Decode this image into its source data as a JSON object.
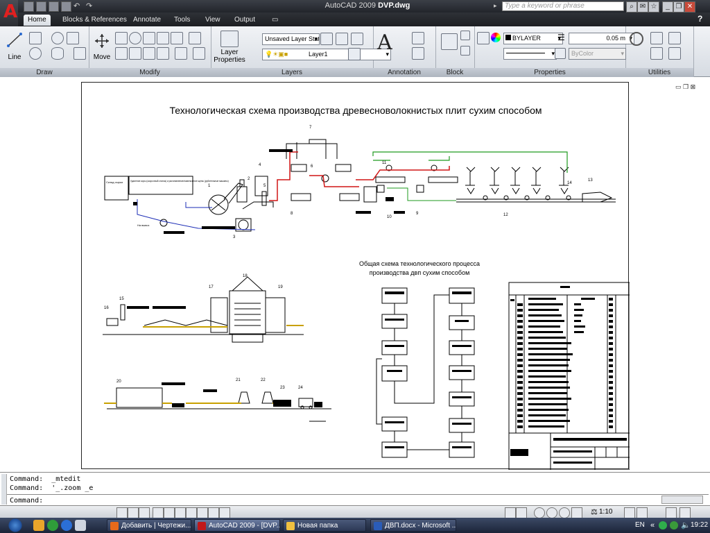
{
  "app": {
    "title": "AutoCAD 2009",
    "document": "DVP.dwg",
    "search_placeholder": "Type a keyword or phrase",
    "help_label": "?"
  },
  "ribbon": {
    "tabs": [
      {
        "label": "Home",
        "active": true
      },
      {
        "label": "Blocks & References"
      },
      {
        "label": "Annotate"
      },
      {
        "label": "Tools"
      },
      {
        "label": "View"
      },
      {
        "label": "Output"
      }
    ],
    "panels": {
      "draw": {
        "title": "Draw",
        "line_label": "Line"
      },
      "modify": {
        "title": "Modify",
        "move_label": "Move"
      },
      "layers": {
        "title": "Layers",
        "layer_properties_label": "Layer Properties",
        "layer_state": "Unsaved Layer State",
        "current_layer": "Layer1"
      },
      "annotation": {
        "title": "Annotation",
        "text_glyph": "A"
      },
      "block": {
        "title": "Block"
      },
      "properties": {
        "title": "Properties",
        "color": "BYLAYER",
        "lineweight": "0.05 m",
        "plotstyle": "ByColor"
      },
      "utilities": {
        "title": "Utilities"
      }
    }
  },
  "drawing": {
    "main_title": "Технологическая схема производства древесноволокнистых плит сухим способом",
    "general_scheme_title_line1": "Общая схема технологического процесса",
    "general_scheme_title_line2": "производства двп сухим способом",
    "box_warehouse": "Склад сырья",
    "box_debarking": "Удаление коры (окорочный станок) и расплавление/измельчение щепы (рубительные машины)",
    "label_discharge": "На вывоз",
    "numbers": [
      "1",
      "2",
      "3",
      "4",
      "5",
      "6",
      "7",
      "8",
      "9",
      "10",
      "11",
      "12",
      "13",
      "14",
      "15",
      "16",
      "17",
      "18",
      "19",
      "20",
      "21",
      "22",
      "23",
      "24"
    ]
  },
  "command_area": {
    "line1": "Command:  _mtedit",
    "line2": "Command:  '_.zoom _e",
    "prompt": "Command:"
  },
  "status_bar": {
    "annotation_scale": "1:10"
  },
  "taskbar": {
    "items": [
      {
        "label": "Добавить | Чертежи...",
        "color": "#e86a1a"
      },
      {
        "label": "AutoCAD 2009 - [DVP...",
        "color": "#c0181b",
        "active": true
      },
      {
        "label": "Новая папка",
        "color": "#f0c040"
      },
      {
        "label": "ДВП.docx - Microsoft ...",
        "color": "#2a5cb8"
      }
    ],
    "language": "EN",
    "clock": "19:22"
  }
}
